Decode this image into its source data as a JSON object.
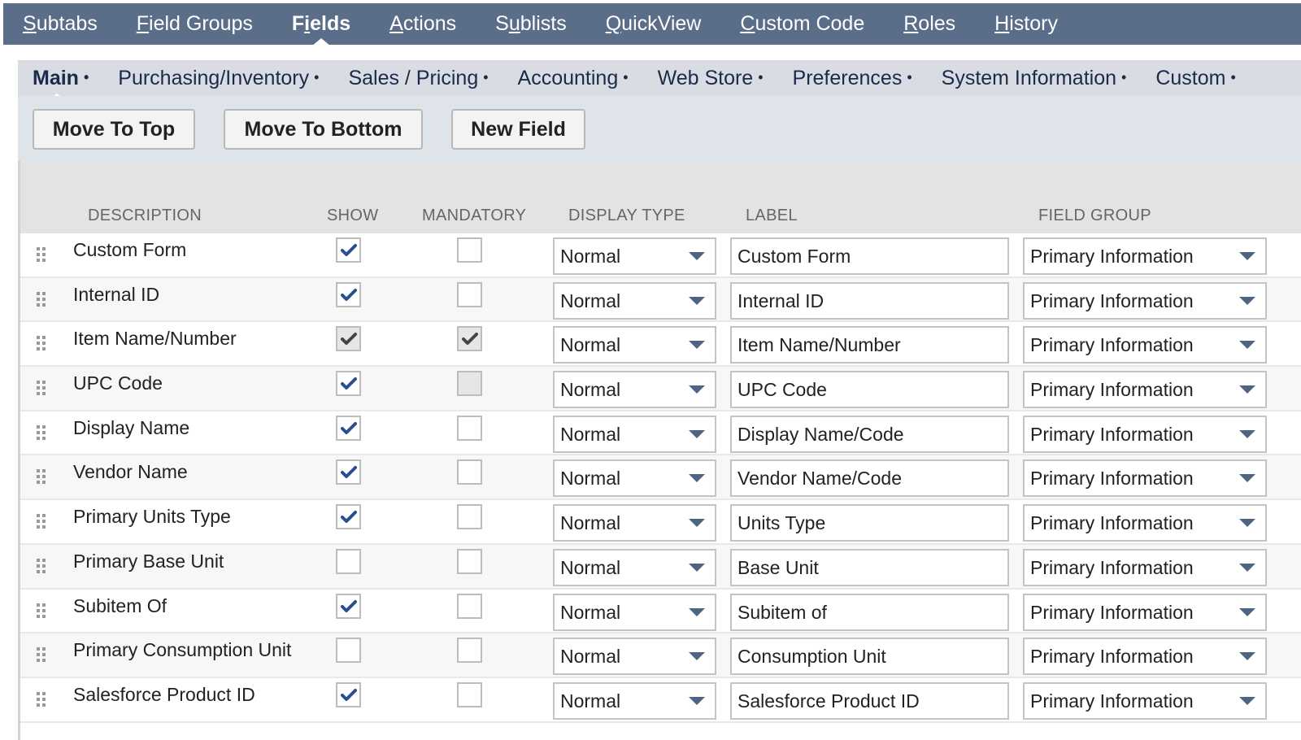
{
  "top_tabs": [
    {
      "label": "Subtabs",
      "accel": "S",
      "rest": "ubtabs",
      "pre": "",
      "active": false
    },
    {
      "label": "Field Groups",
      "accel": "F",
      "rest": "ield Groups",
      "pre": "",
      "active": false
    },
    {
      "label": "Fields",
      "accel": "i",
      "rest": "elds",
      "pre": "F",
      "active": true
    },
    {
      "label": "Actions",
      "accel": "A",
      "rest": "ctions",
      "pre": "",
      "active": false
    },
    {
      "label": "Sublists",
      "accel": "u",
      "rest": "blists",
      "pre": "S",
      "active": false
    },
    {
      "label": "QuickView",
      "accel": "Q",
      "rest": "uickView",
      "pre": "",
      "active": false
    },
    {
      "label": "Custom Code",
      "accel": "C",
      "rest": "ustom Code",
      "pre": "",
      "active": false
    },
    {
      "label": "Roles",
      "accel": "R",
      "rest": "oles",
      "pre": "",
      "active": false
    },
    {
      "label": "History",
      "accel": "H",
      "rest": "istory",
      "pre": "",
      "active": false
    }
  ],
  "sub_tabs": [
    {
      "label": "Main",
      "active": true
    },
    {
      "label": "Purchasing/Inventory",
      "active": false
    },
    {
      "label": "Sales / Pricing",
      "active": false
    },
    {
      "label": "Accounting",
      "active": false
    },
    {
      "label": "Web Store",
      "active": false
    },
    {
      "label": "Preferences",
      "active": false
    },
    {
      "label": "System Information",
      "active": false
    },
    {
      "label": "Custom",
      "active": false
    }
  ],
  "sub_tab_marker": "•",
  "buttons": {
    "move_to_top": "Move To Top",
    "move_to_bottom": "Move To Bottom",
    "new_field": "New Field"
  },
  "columns": {
    "description": "DESCRIPTION",
    "show": "SHOW",
    "mandatory": "MANDATORY",
    "display_type": "DISPLAY TYPE",
    "label": "LABEL",
    "field_group": "FIELD GROUP"
  },
  "colors": {
    "top_bar": "#5a6d89",
    "check_blue": "#2a4f8f",
    "check_grey": "#444444",
    "dropdown_arrow": "#4d6483"
  },
  "rows": [
    {
      "description": "Custom Form",
      "show": "checked",
      "mandatory": "unchecked",
      "display_type": "Normal",
      "label": "Custom Form",
      "field_group": "Primary Information"
    },
    {
      "description": "Internal ID",
      "show": "checked",
      "mandatory": "unchecked",
      "display_type": "Normal",
      "label": "Internal ID",
      "field_group": "Primary Information"
    },
    {
      "description": "Item Name/Number",
      "show": "checked-disabled",
      "mandatory": "checked-disabled",
      "display_type": "Normal",
      "label": "Item Name/Number",
      "field_group": "Primary Information"
    },
    {
      "description": "UPC Code",
      "show": "checked",
      "mandatory": "disabled",
      "display_type": "Normal",
      "label": "UPC Code",
      "field_group": "Primary Information"
    },
    {
      "description": "Display Name",
      "show": "checked",
      "mandatory": "unchecked",
      "display_type": "Normal",
      "label": "Display Name/Code",
      "field_group": "Primary Information"
    },
    {
      "description": "Vendor Name",
      "show": "checked",
      "mandatory": "unchecked",
      "display_type": "Normal",
      "label": "Vendor Name/Code",
      "field_group": "Primary Information"
    },
    {
      "description": "Primary Units Type",
      "show": "checked",
      "mandatory": "unchecked",
      "display_type": "Normal",
      "label": "Units Type",
      "field_group": "Primary Information"
    },
    {
      "description": "Primary Base Unit",
      "show": "unchecked",
      "mandatory": "unchecked",
      "display_type": "Normal",
      "label": "Base Unit",
      "field_group": "Primary Information"
    },
    {
      "description": "Subitem Of",
      "show": "checked",
      "mandatory": "unchecked",
      "display_type": "Normal",
      "label": "Subitem of",
      "field_group": "Primary Information"
    },
    {
      "description": "Primary Consumption Unit",
      "show": "unchecked",
      "mandatory": "unchecked",
      "display_type": "Normal",
      "label": "Consumption Unit",
      "field_group": "Primary Information"
    },
    {
      "description": "Salesforce Product ID",
      "show": "checked",
      "mandatory": "unchecked",
      "display_type": "Normal",
      "label": "Salesforce Product ID",
      "field_group": "Primary Information"
    }
  ]
}
